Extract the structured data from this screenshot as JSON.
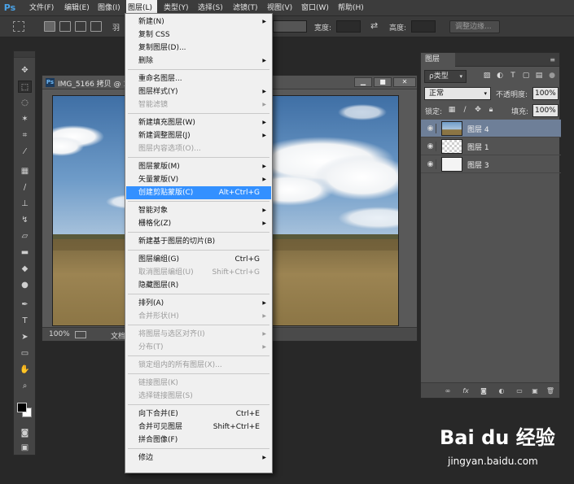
{
  "app": {
    "logo": "Ps"
  },
  "menubar": {
    "items": [
      "文件(F)",
      "编辑(E)",
      "图像(I)",
      "图层(L)",
      "类型(Y)",
      "选择(S)",
      "滤镜(T)",
      "视图(V)",
      "窗口(W)",
      "帮助(H)"
    ],
    "active": "图层(L)"
  },
  "options": {
    "feather_label": "羽",
    "style_label": "",
    "width_label": "宽度:",
    "height_label": "高度:",
    "refine_edge": "调整边缘..."
  },
  "document": {
    "title": "IMG_5166 拷贝 @ 1",
    "zoom": "100%",
    "status": "文档"
  },
  "layer_menu": {
    "items": [
      {
        "label": "新建(N)",
        "arrow": true
      },
      {
        "label": "复制 CSS"
      },
      {
        "label": "复制图层(D)..."
      },
      {
        "label": "删除",
        "arrow": true
      },
      {
        "sep": true
      },
      {
        "label": "重命名图层..."
      },
      {
        "label": "图层样式(Y)",
        "arrow": true
      },
      {
        "label": "智能滤镜",
        "disabled": true,
        "arrow": true
      },
      {
        "sep": true
      },
      {
        "label": "新建填充图层(W)",
        "arrow": true
      },
      {
        "label": "新建调整图层(J)",
        "arrow": true
      },
      {
        "label": "图层内容选项(O)...",
        "disabled": true
      },
      {
        "sep": true
      },
      {
        "label": "图层蒙版(M)",
        "arrow": true
      },
      {
        "label": "矢量蒙版(V)",
        "arrow": true
      },
      {
        "label": "创建剪贴蒙版(C)",
        "shortcut": "Alt+Ctrl+G",
        "highlighted": true
      },
      {
        "sep": true
      },
      {
        "label": "智能对象",
        "arrow": true
      },
      {
        "label": "栅格化(Z)",
        "arrow": true
      },
      {
        "sep": true
      },
      {
        "label": "新建基于图层的切片(B)"
      },
      {
        "sep": true
      },
      {
        "label": "图层编组(G)",
        "shortcut": "Ctrl+G"
      },
      {
        "label": "取消图层编组(U)",
        "shortcut": "Shift+Ctrl+G",
        "disabled": true
      },
      {
        "label": "隐藏图层(R)"
      },
      {
        "sep": true
      },
      {
        "label": "排列(A)",
        "arrow": true
      },
      {
        "label": "合并形状(H)",
        "disabled": true,
        "arrow": true
      },
      {
        "sep": true
      },
      {
        "label": "将图层与选区对齐(I)",
        "disabled": true,
        "arrow": true
      },
      {
        "label": "分布(T)",
        "disabled": true,
        "arrow": true
      },
      {
        "sep": true
      },
      {
        "label": "锁定组内的所有图层(X)...",
        "disabled": true
      },
      {
        "sep": true
      },
      {
        "label": "链接图层(K)",
        "disabled": true
      },
      {
        "label": "选择链接图层(S)",
        "disabled": true
      },
      {
        "sep": true
      },
      {
        "label": "向下合并(E)",
        "shortcut": "Ctrl+E"
      },
      {
        "label": "合并可见图层",
        "shortcut": "Shift+Ctrl+E"
      },
      {
        "label": "拼合图像(F)"
      },
      {
        "sep": true
      },
      {
        "label": "修边",
        "arrow": true
      }
    ]
  },
  "layers_panel": {
    "tab": "图层",
    "filter": "ρ类型",
    "blend_mode": "正常",
    "opacity_label": "不透明度:",
    "opacity_value": "100%",
    "lock_label": "锁定:",
    "fill_label": "填充:",
    "fill_value": "100%",
    "layers": [
      {
        "name": "图层 4",
        "selected": true,
        "thumb": "sky"
      },
      {
        "name": "图层 1",
        "selected": false,
        "thumb": "transparent"
      },
      {
        "name": "图层 3",
        "selected": false,
        "thumb": "white"
      }
    ]
  },
  "watermark": {
    "logo": "Bai du 经验",
    "url": "jingyan.baidu.com"
  }
}
